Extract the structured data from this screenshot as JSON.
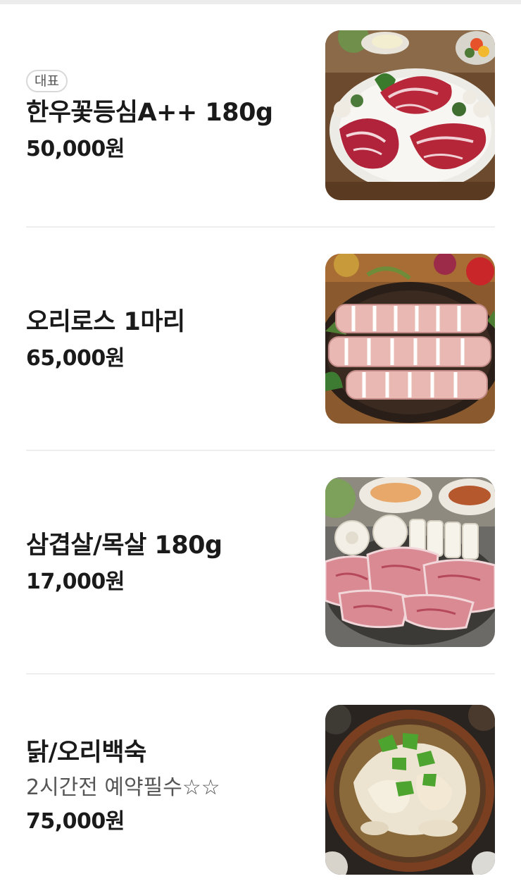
{
  "menu": {
    "items": [
      {
        "badge": "대표",
        "name": "한우꽃등심A++ 180g",
        "description": "",
        "price": "50,000원",
        "image_icon": "beef-ribeye-photo"
      },
      {
        "badge": "",
        "name": "오리로스 1마리",
        "description": "",
        "price": "65,000원",
        "image_icon": "duck-roast-photo"
      },
      {
        "badge": "",
        "name": "삼겹살/목살 180g",
        "description": "",
        "price": "17,000원",
        "image_icon": "pork-belly-photo"
      },
      {
        "badge": "",
        "name": "닭/오리백숙",
        "description": "2시간전 예약필수☆☆",
        "price": "75,000원",
        "image_icon": "chicken-soup-photo"
      }
    ]
  }
}
